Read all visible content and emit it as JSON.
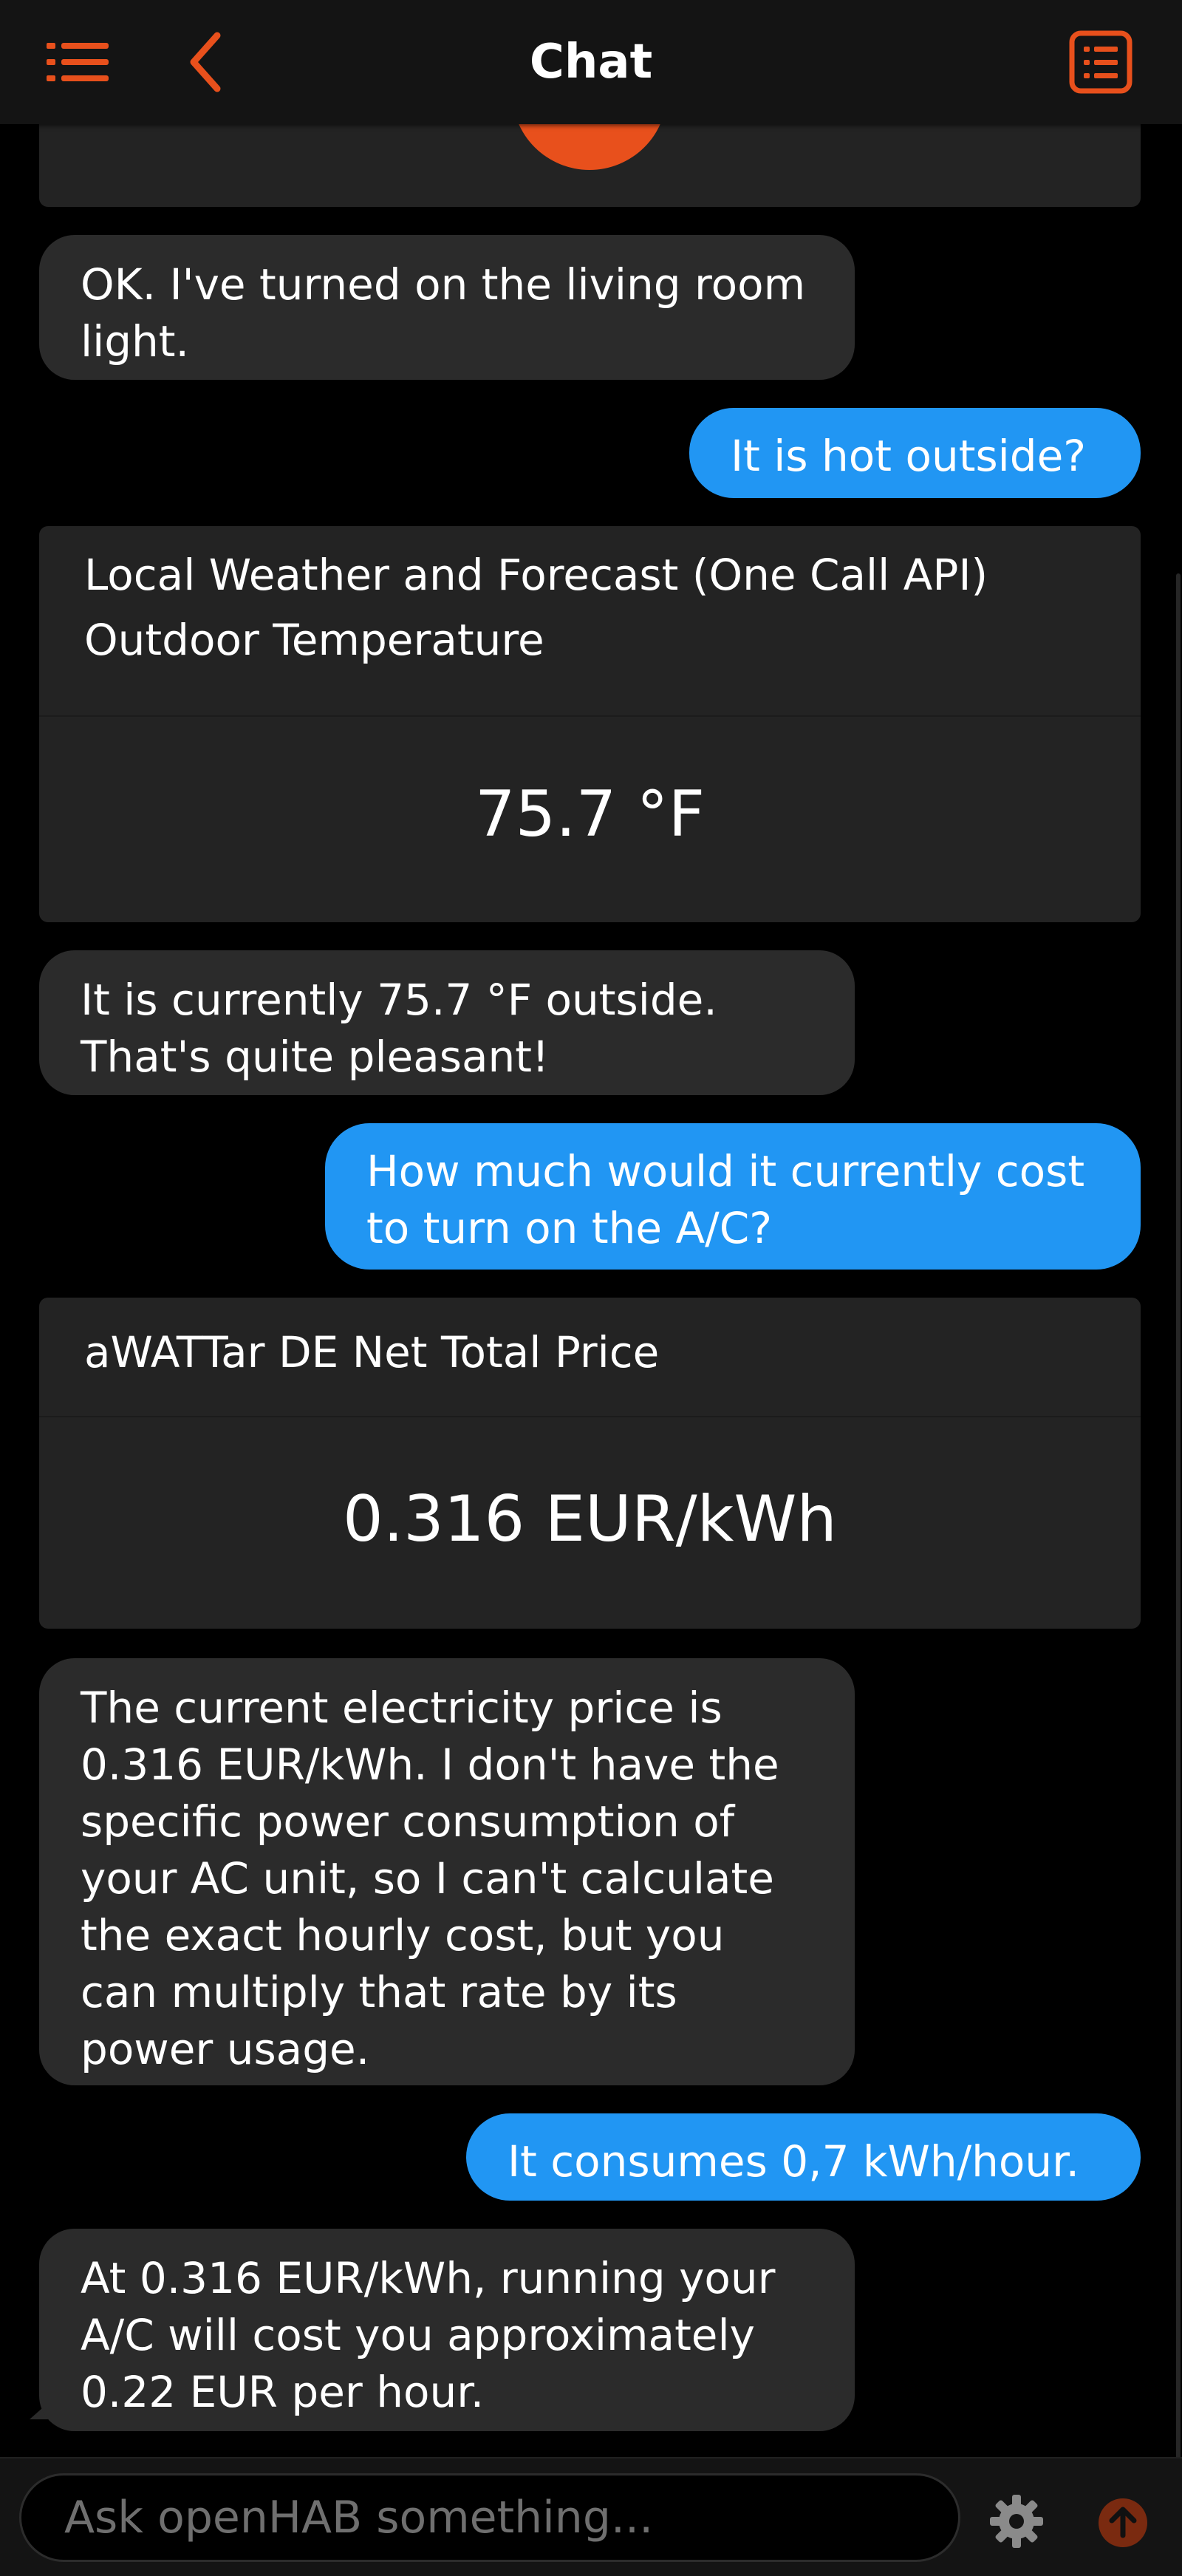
{
  "header": {
    "title": "Chat",
    "menu_icon": "list-menu-icon",
    "back_icon": "chevron-left-icon",
    "right_icon": "list-box-icon",
    "accent_color": "#e8501c"
  },
  "messages": [
    {
      "role": "assistant",
      "text": "OK. I've turned on the living room light."
    },
    {
      "role": "user",
      "text": "It is hot outside?"
    },
    {
      "role": "card",
      "label": "Local Weather and Forecast (One Call API) Outdoor Temperature",
      "value": "75.7 °F"
    },
    {
      "role": "assistant",
      "text": "It is currently 75.7 °F outside. That's quite pleasant!"
    },
    {
      "role": "user",
      "text": "How much would it currently cost to turn on the A/C?"
    },
    {
      "role": "card",
      "label": "aWATTar DE Net Total Price",
      "value": "0.316 EUR/kWh"
    },
    {
      "role": "assistant",
      "text": "The current electricity price is 0.316 EUR/kWh. I don't have the specific power consumption of your AC unit, so I can't calculate the exact hourly cost, but you can multiply that rate by its power usage."
    },
    {
      "role": "user",
      "text": "It consumes 0,7 kWh/hour."
    },
    {
      "role": "assistant",
      "text": "At 0.316 EUR/kWh, running your A/C will cost you approximately 0.22 EUR per hour."
    }
  ],
  "composer": {
    "placeholder": "Ask openHAB something...",
    "settings_icon": "gear-icon",
    "send_icon": "arrow-up-circle-icon",
    "user_bubble_color": "#2196f3",
    "bot_bubble_color": "#2b2b2b"
  }
}
